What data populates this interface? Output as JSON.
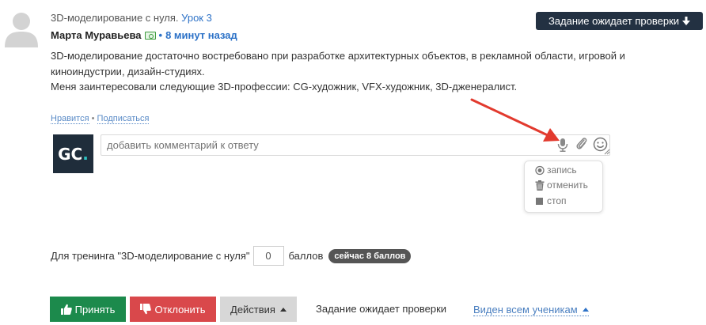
{
  "post": {
    "course_prefix": "3D-моделирование с нуля.",
    "lesson_link": "Урок 3",
    "author": "Марта Муравьева",
    "separator": "•",
    "time_ago": "8 минут назад",
    "status_badge": "Задание ожидает проверки",
    "body": [
      "3D-моделирование достаточно востребовано при разработке архитектурных объектов, в рекламной области, игровой и киноиндустрии, дизайн-студиях.",
      "Меня заинтересовали следующие 3D-профессии: CG-художник, VFX-художник, 3D-дженералист."
    ]
  },
  "meta": {
    "like_link": "Нравится",
    "dot": "•",
    "subscribe_link": "Подписаться"
  },
  "comment": {
    "avatar_text": "GC",
    "avatar_dot": ".",
    "placeholder": "добавить комментарий к ответу"
  },
  "record_menu": {
    "items": [
      "запись",
      "отменить",
      "стоп"
    ]
  },
  "points": {
    "label_prefix": "Для тренинга \"3D-моделирование с нуля\"",
    "value": "0",
    "label_suffix": "баллов",
    "now_badge": "сейчас 8 баллов"
  },
  "actions": {
    "accept": "Принять",
    "reject": "Отклонить",
    "more": "Действия",
    "task_status": "Задание ожидает проверки",
    "visibility": "Виден всем ученикам"
  },
  "colors": {
    "accept": "#1c8a4c",
    "reject": "#d9484b",
    "badge": "#233142",
    "link": "#2d72c7",
    "annotation_arrow": "#e23a2e"
  }
}
